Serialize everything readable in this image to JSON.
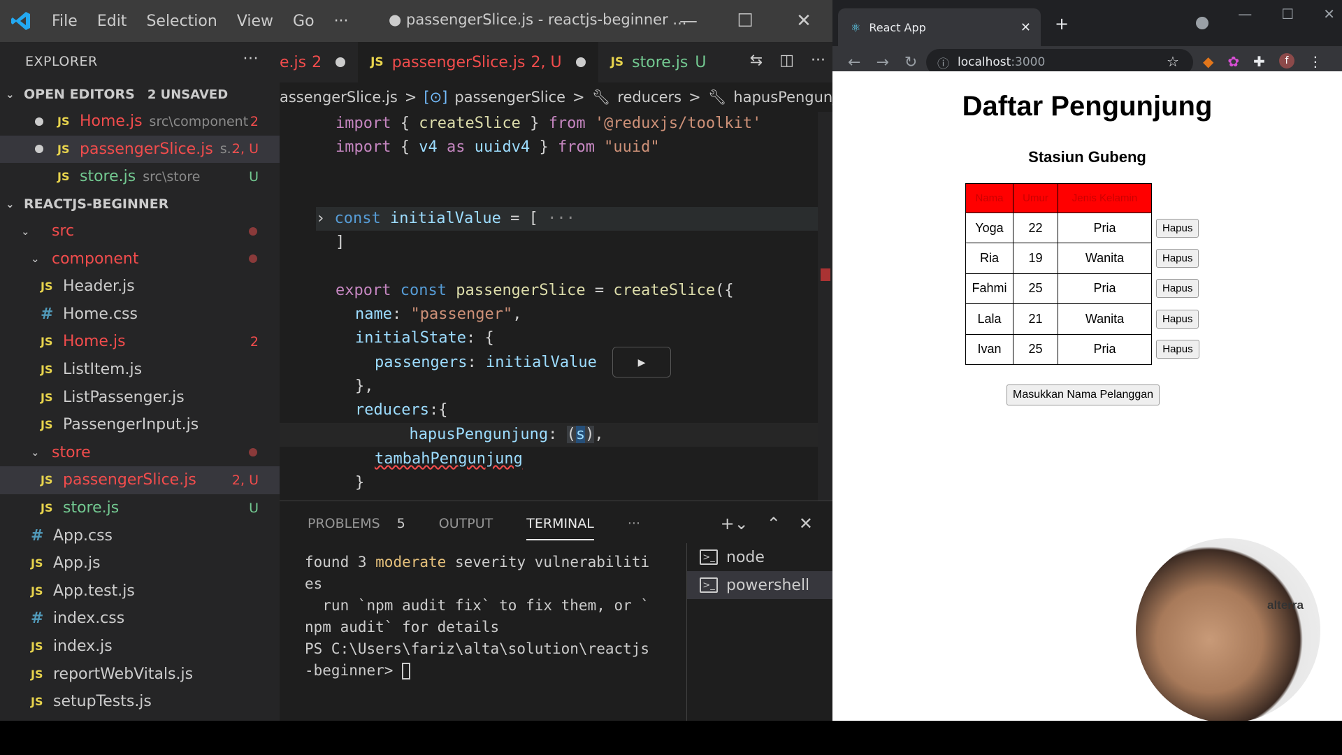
{
  "vscode": {
    "menu": [
      "File",
      "Edit",
      "Selection",
      "View",
      "Go",
      "···"
    ],
    "window_title": "● passengerSlice.js - reactjs-beginner ...",
    "explorer_label": "EXPLORER",
    "explorer_more": "···",
    "open_editors": {
      "label": "OPEN EDITORS",
      "badge": "2 UNSAVED",
      "items": [
        {
          "name": "Home.js",
          "path": "src\\component",
          "status": "2"
        },
        {
          "name": "passengerSlice.js",
          "path": "s...",
          "status": "2, U"
        },
        {
          "name": "store.js",
          "path": "src\\store",
          "status": "U"
        }
      ]
    },
    "project": {
      "label": "REACTJS-BEGINNER",
      "tree": [
        {
          "label": "src",
          "status": ""
        },
        {
          "label": "component",
          "status": ""
        },
        {
          "label": "Header.js",
          "status": ""
        },
        {
          "label": "Home.css",
          "status": ""
        },
        {
          "label": "Home.js",
          "status": "2"
        },
        {
          "label": "ListItem.js",
          "status": ""
        },
        {
          "label": "ListPassenger.js",
          "status": ""
        },
        {
          "label": "PassengerInput.js",
          "status": ""
        },
        {
          "label": "store",
          "status": ""
        },
        {
          "label": "passengerSlice.js",
          "status": "2, U"
        },
        {
          "label": "store.js",
          "status": "U"
        },
        {
          "label": "App.css",
          "status": ""
        },
        {
          "label": "App.js",
          "status": ""
        },
        {
          "label": "App.test.js",
          "status": ""
        },
        {
          "label": "index.css",
          "status": ""
        },
        {
          "label": "index.js",
          "status": ""
        },
        {
          "label": "reportWebVitals.js",
          "status": ""
        },
        {
          "label": "setupTests.js",
          "status": ""
        }
      ]
    },
    "tabs": [
      {
        "name": "e.js",
        "status": "2"
      },
      {
        "name": "passengerSlice.js",
        "status": "2, U"
      },
      {
        "name": "store.js",
        "status": "U"
      }
    ],
    "breadcrumb": [
      "assengerSlice.js",
      ">",
      "passengerSlice",
      ">",
      "reducers",
      ">",
      "hapusPengunjung"
    ],
    "panel": {
      "tabs": [
        "PROBLEMS",
        "OUTPUT",
        "TERMINAL",
        "···"
      ],
      "problems_count": "5",
      "terminal_lines": [
        "found 3 moderate severity vulnerabiliti",
        "es",
        "  run `npm audit fix` to fix them, or `",
        "npm audit` for details",
        "PS C:\\Users\\fariz\\alta\\solution\\reactjs",
        "-beginner> "
      ],
      "terminals": [
        "node",
        "powershell"
      ]
    }
  },
  "browser": {
    "tab_title": "React App",
    "url_host": "localhost",
    "url_port": ":3000",
    "avatar_letter": "f"
  },
  "page": {
    "title": "Daftar Pengunjung",
    "subtitle": "Stasiun Gubeng",
    "headers": [
      "Nama",
      "Umur",
      "Jenis Kelamin"
    ],
    "rows": [
      {
        "nama": "Yoga",
        "umur": "22",
        "jk": "Pria"
      },
      {
        "nama": "Ria",
        "umur": "19",
        "jk": "Wanita"
      },
      {
        "nama": "Fahmi",
        "umur": "25",
        "jk": "Pria"
      },
      {
        "nama": "Lala",
        "umur": "21",
        "jk": "Wanita"
      },
      {
        "nama": "Ivan",
        "umur": "25",
        "jk": "Pria"
      }
    ],
    "delete_label": "Hapus",
    "add_label": "Masukkan Nama Pelanggan"
  },
  "webcam": {
    "logo_text": "alterra"
  }
}
